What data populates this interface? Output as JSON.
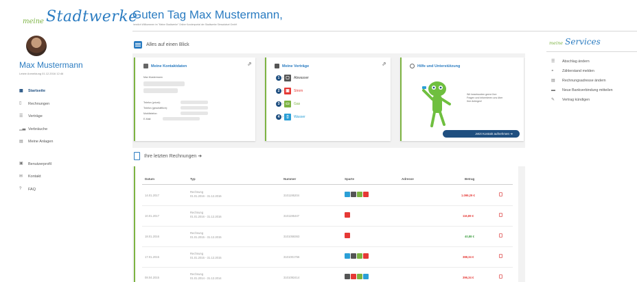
{
  "logo": {
    "small": "meine",
    "big": "Stadtwerke"
  },
  "user": {
    "name": "Max Mustermann",
    "last_login": "Letzte Anmeldung 01.12.2016 12:46"
  },
  "sidebar": {
    "items": [
      {
        "label": "Startseite",
        "icon": "grid-icon",
        "active": true
      },
      {
        "label": "Rechnungen",
        "icon": "document-icon"
      },
      {
        "label": "Verträge",
        "icon": "list-icon"
      },
      {
        "label": "Verbräuche",
        "icon": "bar-chart-icon"
      },
      {
        "label": "Meine Anlagen",
        "icon": "building-icon"
      }
    ],
    "items2": [
      {
        "label": "Benutzerprofil",
        "icon": "user-icon"
      },
      {
        "label": "Kontakt",
        "icon": "mail-icon"
      },
      {
        "label": "FAQ",
        "icon": "help-icon"
      }
    ]
  },
  "header": {
    "greeting": "Guten Tag Max Mustermann,",
    "subtitle": "herzlich Willkommen im \"Meine Stadtwerke\" Online Kundenportal der Stadtwerke Simsalaburt GmbH"
  },
  "overview": {
    "title": "Alles auf einen Blick",
    "contact": {
      "title": "Meine Kontaktdaten",
      "name": "Max Mustermann",
      "fields": [
        "Telefon (privat):",
        "Telefon (geschäftlich):",
        "Mobiltelefon:",
        "E-Mail:"
      ]
    },
    "contracts": {
      "title": "Meine Verträge",
      "items": [
        {
          "num": "1",
          "label": "Abwasser",
          "color": "#555555",
          "text_color": "#444444"
        },
        {
          "num": "2",
          "label": "Strom",
          "color": "#e53935",
          "text_color": "#e53935"
        },
        {
          "num": "3",
          "label": "Gas",
          "color": "#7cb342",
          "text_color": "#7cb342"
        },
        {
          "num": "4",
          "label": "Wasser",
          "color": "#2b9fd6",
          "text_color": "#2b9fd6"
        }
      ]
    },
    "help": {
      "title": "Hilfe und Unterstützung",
      "text": "Wir beantworten gerne Ihre Fragen und informieren uns über Ihre Anliegen!",
      "button": "Jetzt Kontakt aufnehmen  ➜"
    }
  },
  "invoices": {
    "title": "Ihre letzten Rechnungen  ➜",
    "columns": [
      "Datum",
      "Typ",
      "Nummer",
      "Sparte",
      "Adresse",
      "Betrag"
    ],
    "rows": [
      {
        "date": "14.01.2017",
        "type": "Rechnung",
        "period": "01.01.2016 - 31.12.2016",
        "number": "3101195204",
        "sparte": [
          "#2b9fd6",
          "#555555",
          "#7cb342",
          "#e53935"
        ],
        "amount": "1.099,29 €",
        "positive": false
      },
      {
        "date": "10.01.2017",
        "type": "Rechnung",
        "period": "01.01.2016 - 31.12.2016",
        "number": "3101195447",
        "sparte": [
          "#e53935"
        ],
        "amount": "116,89 €",
        "positive": false
      },
      {
        "date": "18.01.2016",
        "type": "Rechnung",
        "period": "01.01.2015 - 31.12.2015",
        "number": "3101058363",
        "sparte": [
          "#e53935"
        ],
        "amount": "40,88 €",
        "positive": true
      },
      {
        "date": "17.01.2015",
        "type": "Rechnung",
        "period": "01.01.2015 - 31.12.2015",
        "number": "3101001756",
        "sparte": [
          "#2b9fd6",
          "#555555",
          "#7cb342",
          "#e53935"
        ],
        "amount": "388,34 €",
        "positive": false
      },
      {
        "date": "08.04.2015",
        "type": "Rechnung",
        "period": "01.01.2014 - 31.12.2014",
        "number": "3101092414",
        "sparte": [
          "#555555",
          "#e53935",
          "#7cb342",
          "#2b9fd6"
        ],
        "amount": "396,34 €",
        "positive": false
      }
    ]
  },
  "services": {
    "title_small": "meine",
    "title": "Services",
    "items": [
      {
        "label": "Abschlag ändern",
        "icon": "list-icon"
      },
      {
        "label": "Zählerstand melden",
        "icon": "gauge-icon"
      },
      {
        "label": "Rechnungsadresse ändern",
        "icon": "document-icon"
      },
      {
        "label": "Neue Bankverbindung mitteilen",
        "icon": "card-icon"
      },
      {
        "label": "Vertrag kündigen",
        "icon": "pen-icon"
      }
    ]
  },
  "colors": {
    "accent": "#2b7cc1",
    "green": "#7cb342",
    "red": "#e53935",
    "navy": "#1f4f80"
  }
}
